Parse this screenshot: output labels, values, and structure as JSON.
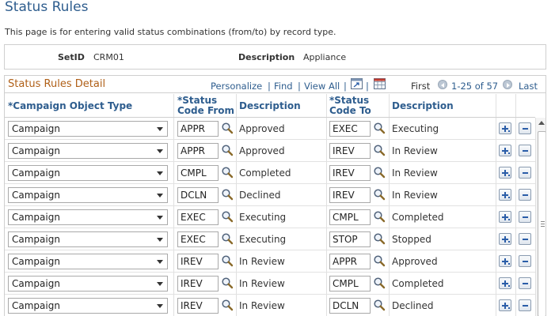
{
  "page": {
    "title": "Status Rules",
    "description": "This page is for entering valid status combinations (from/to) by record type."
  },
  "setid_section": {
    "setid_label": "SetID",
    "setid_value": "CRM01",
    "description_label": "Description",
    "description_value": "Appliance"
  },
  "grid": {
    "title": "Status Rules Detail",
    "nav": {
      "personalize": "Personalize",
      "separator": "|",
      "find": "Find",
      "view_all": "View All",
      "first": "First",
      "range": "1-25 of 57",
      "last": "Last"
    },
    "columns": {
      "object_type": "*Campaign Object Type",
      "status_from_line1": "*Status",
      "status_from_line2": "Code From",
      "description_from": "Description",
      "status_to_line1": "*Status",
      "status_to_line2": "Code To",
      "description_to": "Description"
    },
    "rows": [
      {
        "object_type": "Campaign",
        "from_code": "APPR",
        "from_desc": "Approved",
        "to_code": "EXEC",
        "to_desc": "Executing"
      },
      {
        "object_type": "Campaign",
        "from_code": "APPR",
        "from_desc": "Approved",
        "to_code": "IREV",
        "to_desc": "In Review"
      },
      {
        "object_type": "Campaign",
        "from_code": "CMPL",
        "from_desc": "Completed",
        "to_code": "IREV",
        "to_desc": "In Review"
      },
      {
        "object_type": "Campaign",
        "from_code": "DCLN",
        "from_desc": "Declined",
        "to_code": "IREV",
        "to_desc": "In Review"
      },
      {
        "object_type": "Campaign",
        "from_code": "EXEC",
        "from_desc": "Executing",
        "to_code": "CMPL",
        "to_desc": "Completed"
      },
      {
        "object_type": "Campaign",
        "from_code": "EXEC",
        "from_desc": "Executing",
        "to_code": "STOP",
        "to_desc": "Stopped"
      },
      {
        "object_type": "Campaign",
        "from_code": "IREV",
        "from_desc": "In Review",
        "to_code": "APPR",
        "to_desc": "Approved"
      },
      {
        "object_type": "Campaign",
        "from_code": "IREV",
        "from_desc": "In Review",
        "to_code": "CMPL",
        "to_desc": "Completed"
      },
      {
        "object_type": "Campaign",
        "from_code": "IREV",
        "from_desc": "In Review",
        "to_code": "DCLN",
        "to_desc": "Declined"
      }
    ]
  },
  "icons": {
    "lookup": "magnifier-icon",
    "add_row": "add-row-icon",
    "delete_row": "delete-row-icon",
    "zoom": "zoom-grid-icon",
    "download": "download-spreadsheet-icon"
  },
  "colors": {
    "title": "#2e5d8e",
    "grid_title": "#b06018",
    "link": "#2e5d8e"
  }
}
